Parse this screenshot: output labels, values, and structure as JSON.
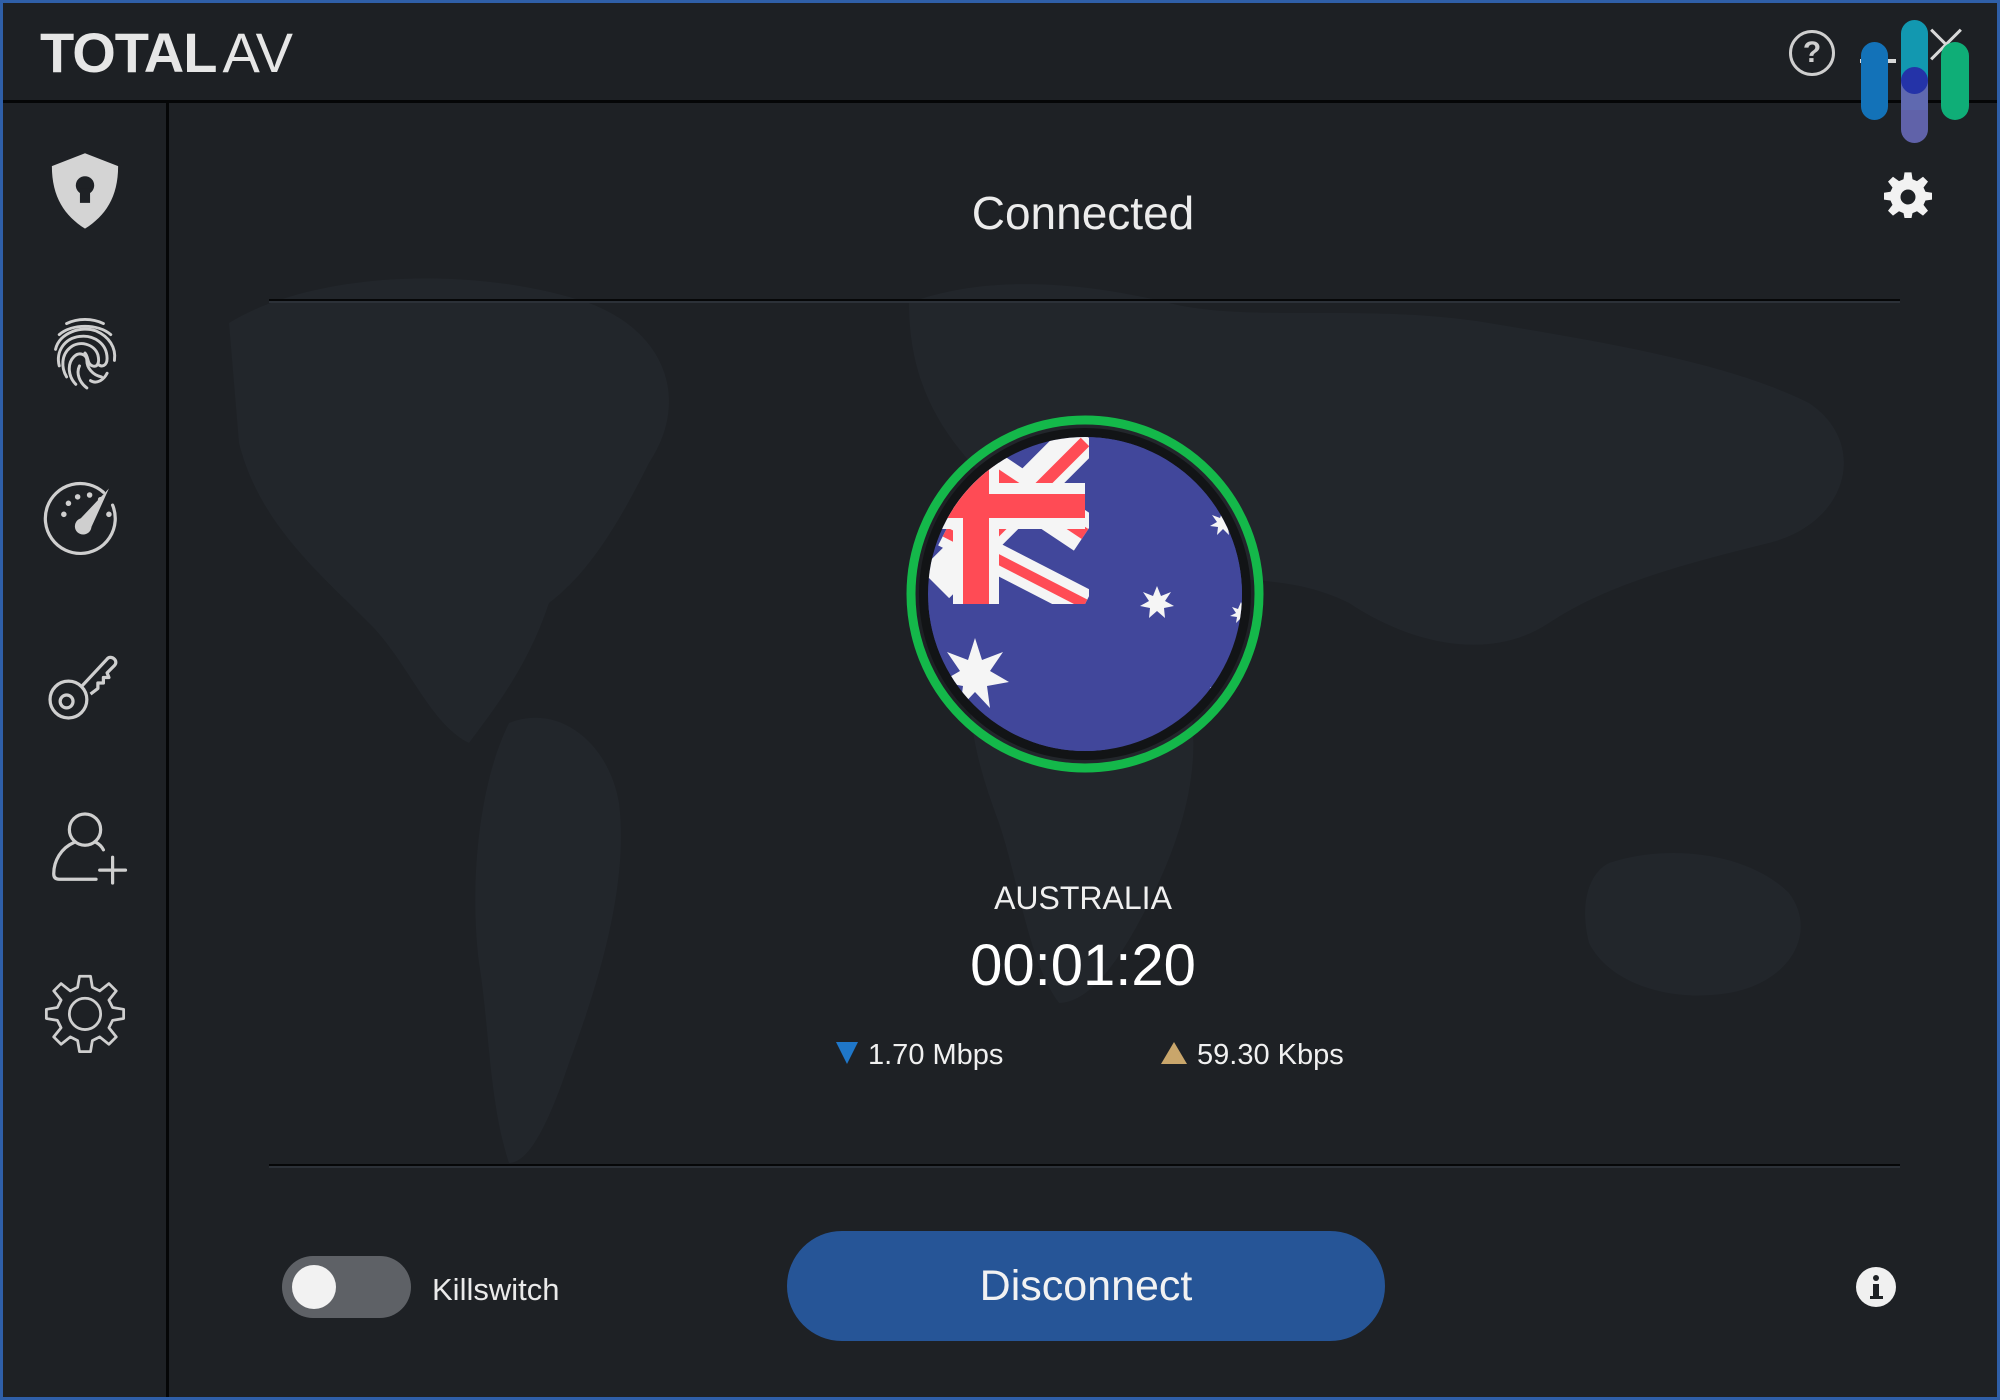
{
  "app": {
    "brand_bold": "TOTAL",
    "brand_light": "AV",
    "help_label": "?",
    "window_controls": [
      "minimize",
      "close"
    ]
  },
  "sidebar": {
    "items": [
      {
        "id": "vpn",
        "icon": "shield-lock-icon",
        "active": true
      },
      {
        "id": "identity",
        "icon": "fingerprint-icon",
        "active": false
      },
      {
        "id": "speed",
        "icon": "speedometer-icon",
        "active": false
      },
      {
        "id": "passwords",
        "icon": "key-icon",
        "active": false
      },
      {
        "id": "account",
        "icon": "add-user-icon",
        "active": false
      },
      {
        "id": "settings",
        "icon": "gear-icon",
        "active": false
      }
    ]
  },
  "vpn": {
    "status": "Connected",
    "country": "AUSTRALIA",
    "duration": "00:01:20",
    "download_speed": "1.70 Mbps",
    "upload_speed": "59.30 Kbps",
    "killswitch_label": "Killswitch",
    "killswitch_on": false,
    "disconnect_label": "Disconnect"
  },
  "colors": {
    "accent_button": "#265597",
    "connected_ring": "#14b84a",
    "download_arrow": "#1f77c9",
    "upload_arrow": "#c9a66b",
    "window_border": "#2f5fa8",
    "background": "#1e2125"
  }
}
